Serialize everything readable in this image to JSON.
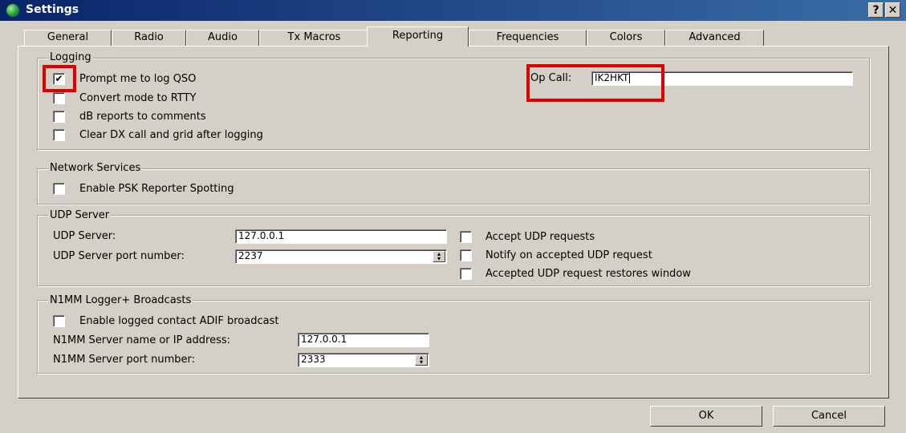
{
  "window": {
    "title": "Settings",
    "help_glyph": "?",
    "close_glyph": "✕"
  },
  "tabs": [
    {
      "label": "General",
      "active": false
    },
    {
      "label": "Radio",
      "active": false
    },
    {
      "label": "Audio",
      "active": false
    },
    {
      "label": "Tx Macros",
      "active": false
    },
    {
      "label": "Reporting",
      "active": true
    },
    {
      "label": "Frequencies",
      "active": false
    },
    {
      "label": "Colors",
      "active": false
    },
    {
      "label": "Advanced",
      "active": false
    }
  ],
  "logging": {
    "legend": "Logging",
    "prompt_log_label": "Prompt me to log QSO",
    "prompt_log_checked": true,
    "convert_rtty_label": "Convert mode to RTTY",
    "convert_rtty_checked": false,
    "db_reports_label": "dB reports to comments",
    "db_reports_checked": false,
    "clear_dx_label": "Clear DX call and grid after logging",
    "clear_dx_checked": false,
    "op_call_label": "Op Call:",
    "op_call_value": "IK2HKT"
  },
  "network_services": {
    "legend": "Network Services",
    "psk_reporter_label": "Enable PSK Reporter Spotting",
    "psk_reporter_checked": false
  },
  "udp_server": {
    "legend": "UDP Server",
    "server_label": "UDP Server:",
    "server_value": "127.0.0.1",
    "port_label": "UDP Server port number:",
    "port_value": "2237",
    "accept_label": "Accept UDP requests",
    "accept_checked": false,
    "notify_label": "Notify on accepted UDP request",
    "notify_checked": false,
    "restore_label": "Accepted UDP request restores window",
    "restore_checked": false
  },
  "n1mm": {
    "legend": "N1MM Logger+  Broadcasts",
    "adif_label": "Enable logged contact ADIF broadcast",
    "adif_checked": false,
    "server_label": "N1MM Server name or IP address:",
    "server_value": "127.0.0.1",
    "port_label": "N1MM Server port number:",
    "port_value": "2333"
  },
  "buttons": {
    "ok": "OK",
    "cancel": "Cancel"
  },
  "colors": {
    "highlight": "#e00000",
    "titlebar": "#0a246a",
    "dialog": "#d4d0c8"
  }
}
